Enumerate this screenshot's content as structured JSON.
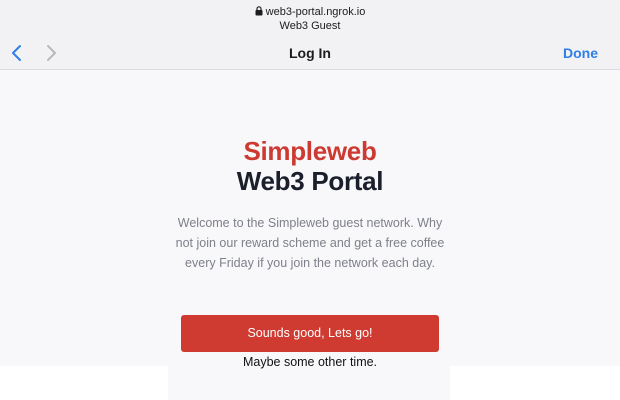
{
  "browser": {
    "url": "web3-portal.ngrok.io",
    "site_name": "Web3 Guest",
    "nav_title": "Log In",
    "done_label": "Done",
    "icons": {
      "lock": "lock-icon",
      "back": "chevron-left-icon",
      "forward": "chevron-right-icon"
    },
    "accent_color": "#2f7ee8"
  },
  "page": {
    "brand": "Simpleweb",
    "title": "Web3 Portal",
    "welcome_text": "Welcome to the Simpleweb guest network. Why not join our reward scheme and get a free coffee every Friday if you join the network each day.",
    "primary_button": "Sounds good, Lets go!",
    "secondary_link": "Maybe some other time.",
    "brand_color": "#cc3a32",
    "button_color": "#cf3a31"
  }
}
